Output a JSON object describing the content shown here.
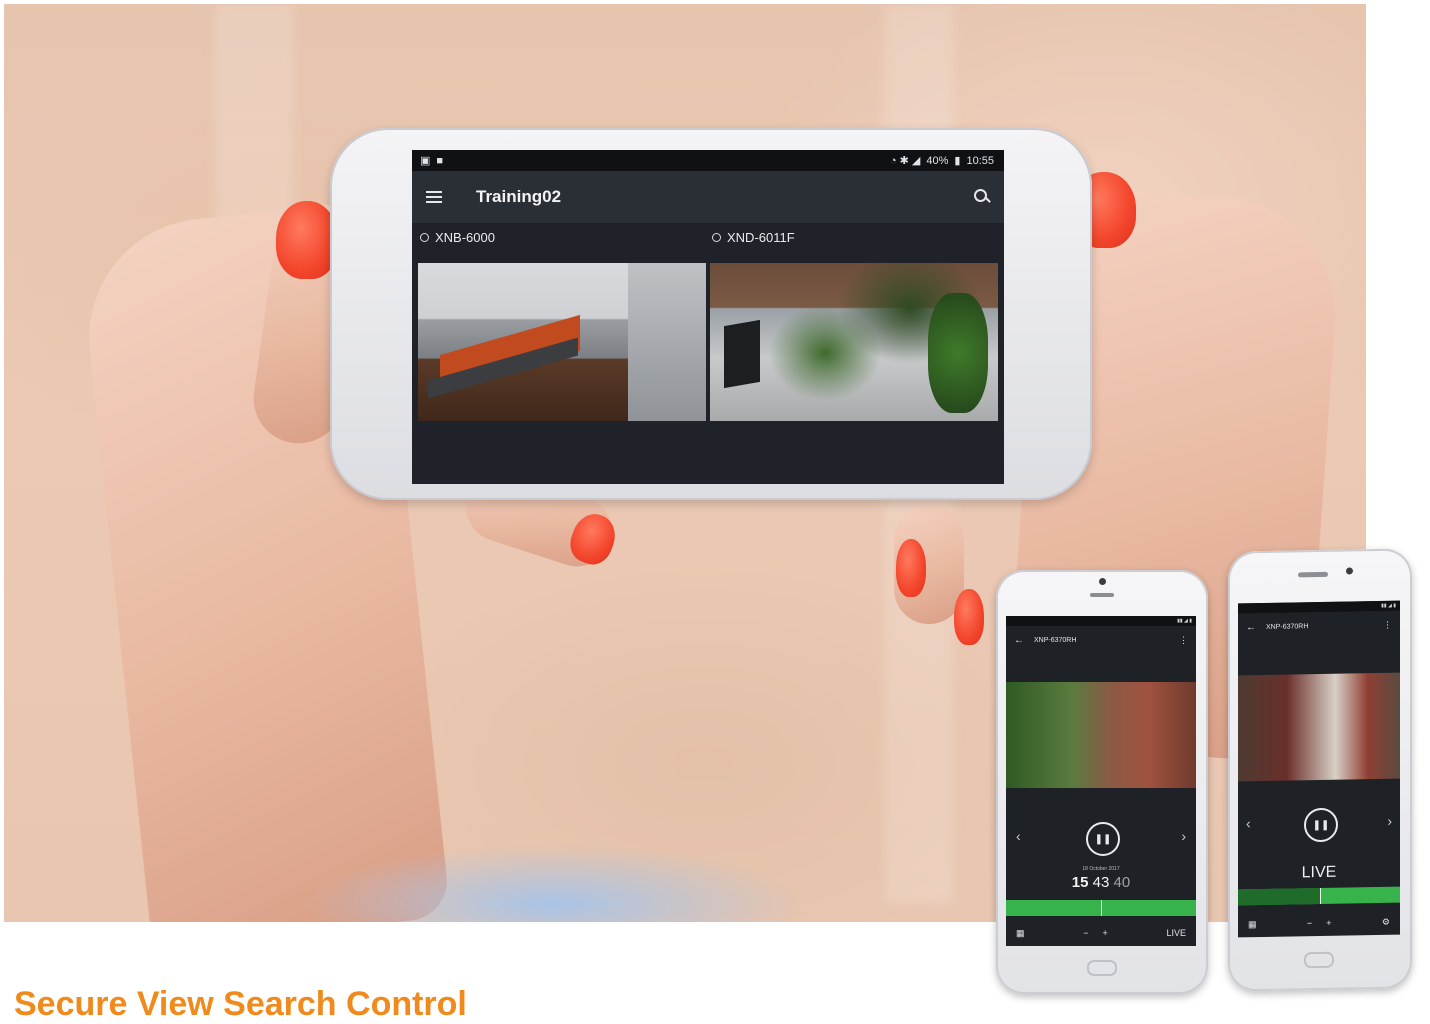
{
  "main_phone": {
    "status_bar": {
      "battery": "40%",
      "time": "10:55"
    },
    "app_title": "Training02",
    "cameras": [
      {
        "label": "XNB-6000"
      },
      {
        "label": "XND-6011F"
      }
    ]
  },
  "phone_playback": {
    "title": "XNP-6370RH",
    "date": "18 October 2017",
    "time_h": "15",
    "time_m": "43",
    "time_s": "40",
    "bottom_mode": "LIVE"
  },
  "phone_live": {
    "title": "XNP-6370RH",
    "mode_label": "LIVE"
  },
  "heading": "Secure View Search Control",
  "colors": {
    "accent": "#f08a1c",
    "timeline": "#38b24a",
    "nail": "#f3452b"
  },
  "icons": [
    "menu-icon",
    "search-icon",
    "pause-icon",
    "back-arrow-icon",
    "more-icon",
    "calendar-icon",
    "settings-icon"
  ]
}
